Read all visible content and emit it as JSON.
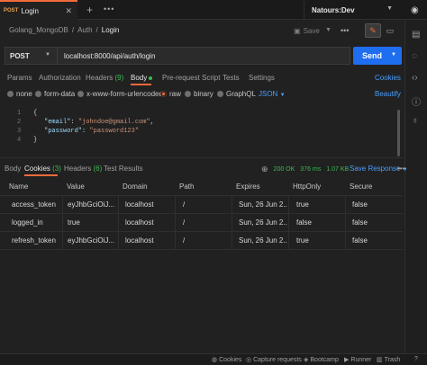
{
  "tabs": {
    "active": {
      "method": "POST",
      "title": "Login"
    },
    "more": "•••"
  },
  "environment": {
    "name": "Natours:Dev"
  },
  "breadcrumb": {
    "collection": "Golang_MongoDB",
    "folder": "Auth",
    "request": "Login",
    "sep": "/"
  },
  "toolbar": {
    "save_label": "Save"
  },
  "request": {
    "method": "POST",
    "url": "localhost:8000/api/auth/login",
    "send_label": "Send"
  },
  "request_tabs": {
    "params": "Params",
    "authorization": "Authorization",
    "headers": "Headers",
    "headers_count": "(9)",
    "body": "Body",
    "prerequest": "Pre-request Script",
    "tests": "Tests",
    "settings": "Settings",
    "cookies": "Cookies"
  },
  "body_types": {
    "none": "none",
    "form_data": "form-data",
    "urlencoded": "x-www-form-urlencoded",
    "raw": "raw",
    "binary": "binary",
    "graphql": "GraphQL",
    "format": "JSON",
    "beautify": "Beautify"
  },
  "editor": {
    "lines": [
      "1",
      "2",
      "3",
      "4"
    ],
    "open": "{",
    "close": "}",
    "email_key": "\"email\"",
    "email_val": "\"johndoe@gmail.com\"",
    "password_key": "\"password\"",
    "password_val": "\"password123\""
  },
  "response_tabs": {
    "body": "Body",
    "cookies": "Cookies",
    "cookies_count": "(3)",
    "headers": "Headers",
    "headers_count": "(6)",
    "test_results": "Test Results"
  },
  "response_status": {
    "status": "200 OK",
    "time": "376 ms",
    "size": "1.07 KB",
    "save_label": "Save Response"
  },
  "cookie_table": {
    "headers": [
      "Name",
      "Value",
      "Domain",
      "Path",
      "Expires",
      "HttpOnly",
      "Secure"
    ],
    "rows": [
      [
        "access_token",
        "eyJhbGciOiJ...",
        "localhost",
        "/",
        "Sun, 26 Jun 2...",
        "true",
        "false"
      ],
      [
        "logged_in",
        "true",
        "localhost",
        "/",
        "Sun, 26 Jun 2...",
        "false",
        "false"
      ],
      [
        "refresh_token",
        "eyJhbGciOiJ...",
        "localhost",
        "/",
        "Sun, 26 Jun 2...",
        "true",
        "false"
      ]
    ]
  },
  "statusbar": {
    "cookies": "Cookies",
    "capture": "Capture requests",
    "bootcamp": "Bootcamp",
    "runner": "Runner",
    "trash": "Trash"
  }
}
